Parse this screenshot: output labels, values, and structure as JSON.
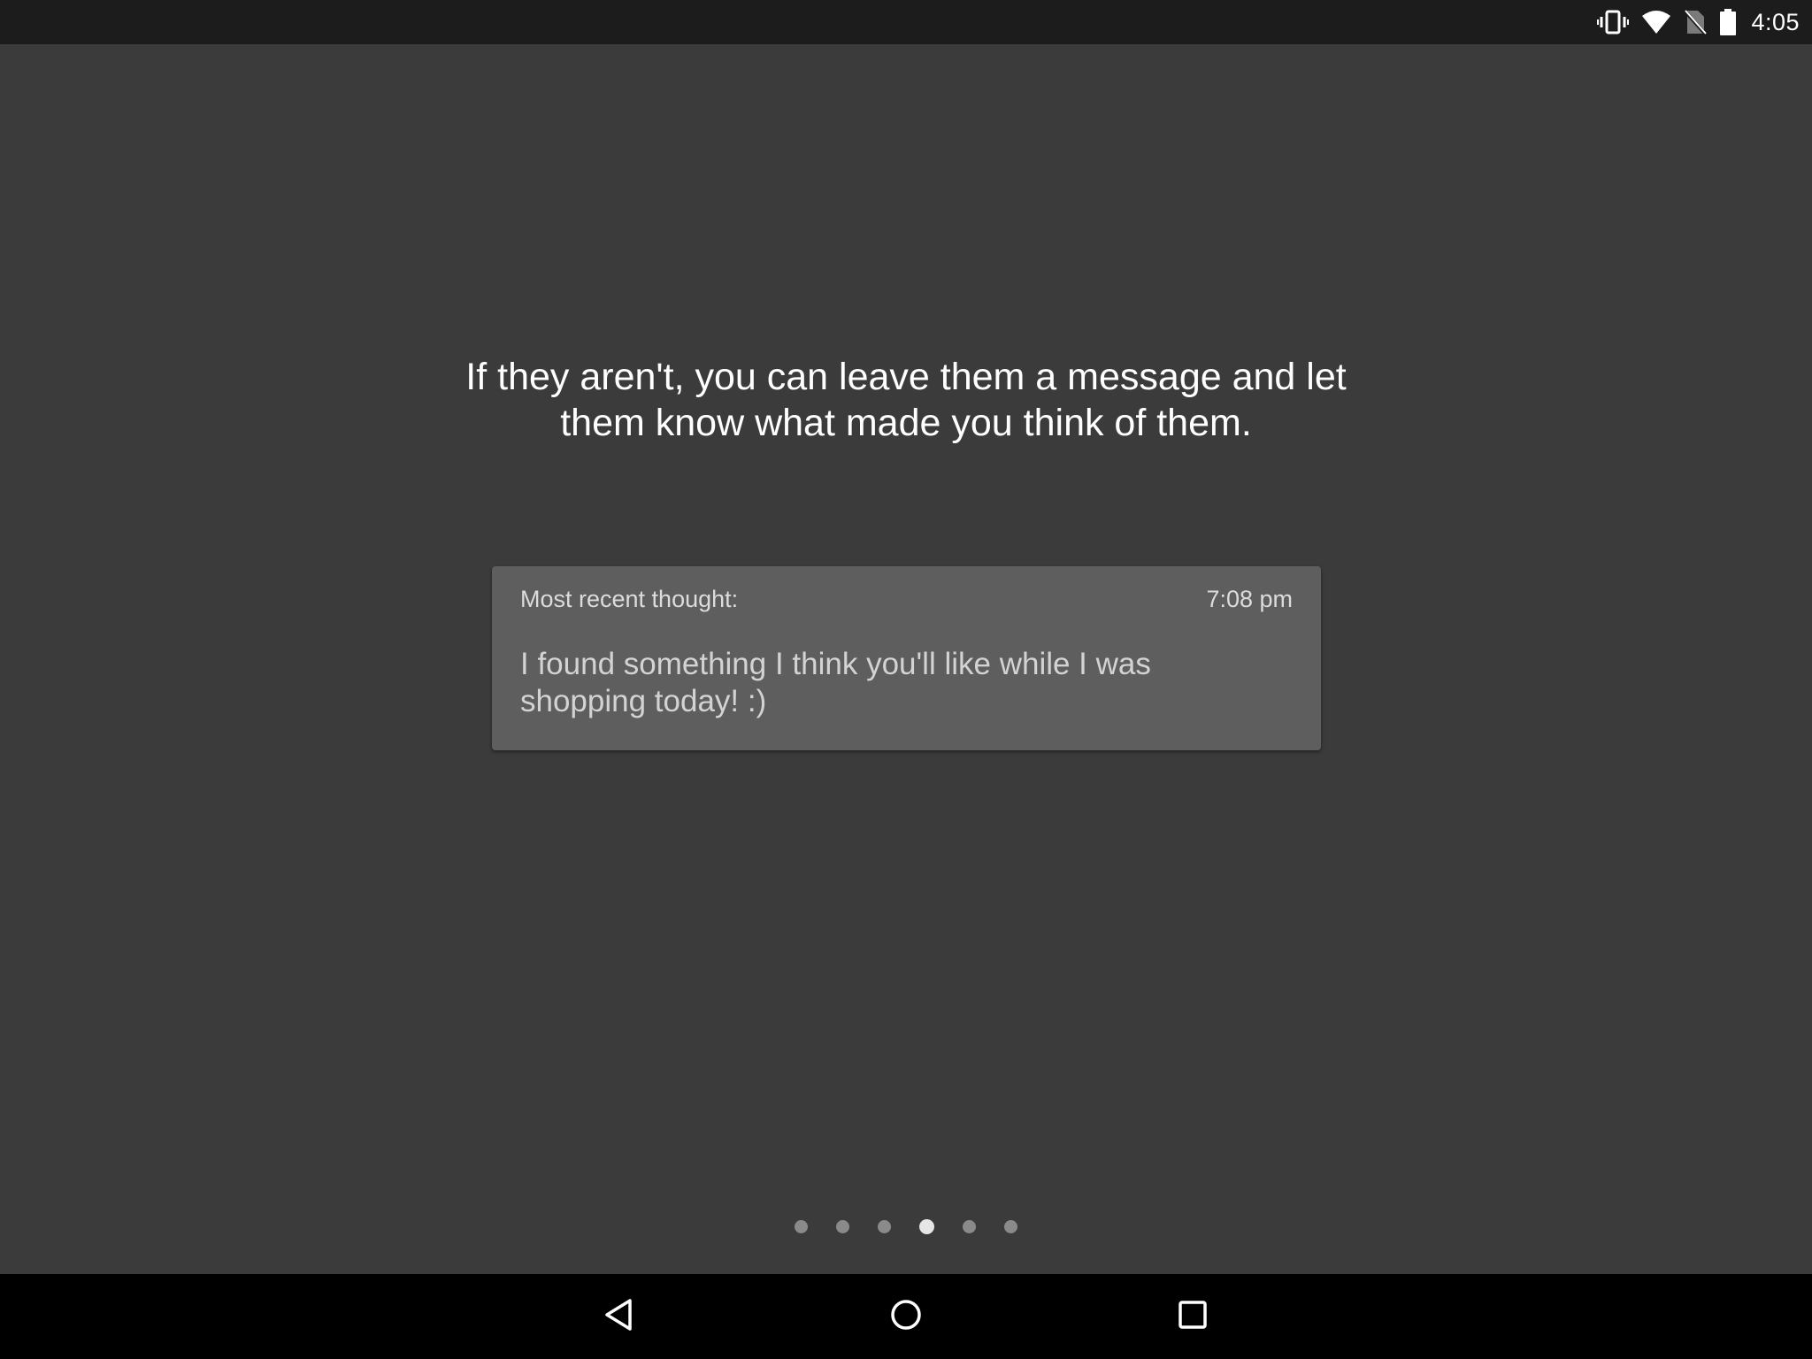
{
  "status_bar": {
    "time": "4:05",
    "icons": [
      "vibrate-icon",
      "wifi-icon",
      "no-sim-icon",
      "battery-icon"
    ]
  },
  "main": {
    "headline": "If they aren't, you can leave them a message and let them know what made you think of them.",
    "card": {
      "label": "Most recent thought:",
      "time": "7:08 pm",
      "message": "I found something I think you'll like while I was shopping today! :)"
    },
    "pager": {
      "count": 6,
      "active_index": 3
    }
  },
  "nav_bar": {
    "buttons": [
      "back-icon",
      "home-icon",
      "recents-icon"
    ]
  },
  "colors": {
    "background": "#3b3b3b",
    "status_bar": "#1c1c1c",
    "card": "#5e5e5e",
    "nav_bar": "#000000"
  }
}
